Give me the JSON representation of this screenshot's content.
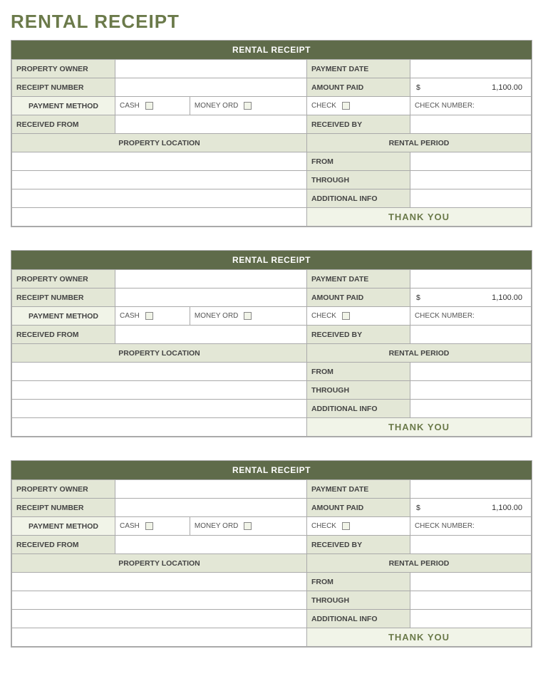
{
  "title": "RENTAL RECEIPT",
  "header": "RENTAL RECEIPT",
  "labels": {
    "property_owner": "PROPERTY OWNER",
    "payment_date": "PAYMENT DATE",
    "receipt_number": "RECEIPT NUMBER",
    "amount_paid": "AMOUNT PAID",
    "payment_method": "PAYMENT METHOD",
    "cash": "CASH",
    "money_ord": "MONEY ORD",
    "check": "CHECK",
    "check_number": "CHECK NUMBER:",
    "received_from": "RECEIVED FROM",
    "received_by": "RECEIVED BY",
    "property_location": "PROPERTY LOCATION",
    "rental_period": "RENTAL PERIOD",
    "from": "FROM",
    "through": "THROUGH",
    "additional_info": "ADDITIONAL INFO",
    "thank_you": "THANK YOU"
  },
  "amount": {
    "currency": "$",
    "value": "1,100.00"
  }
}
